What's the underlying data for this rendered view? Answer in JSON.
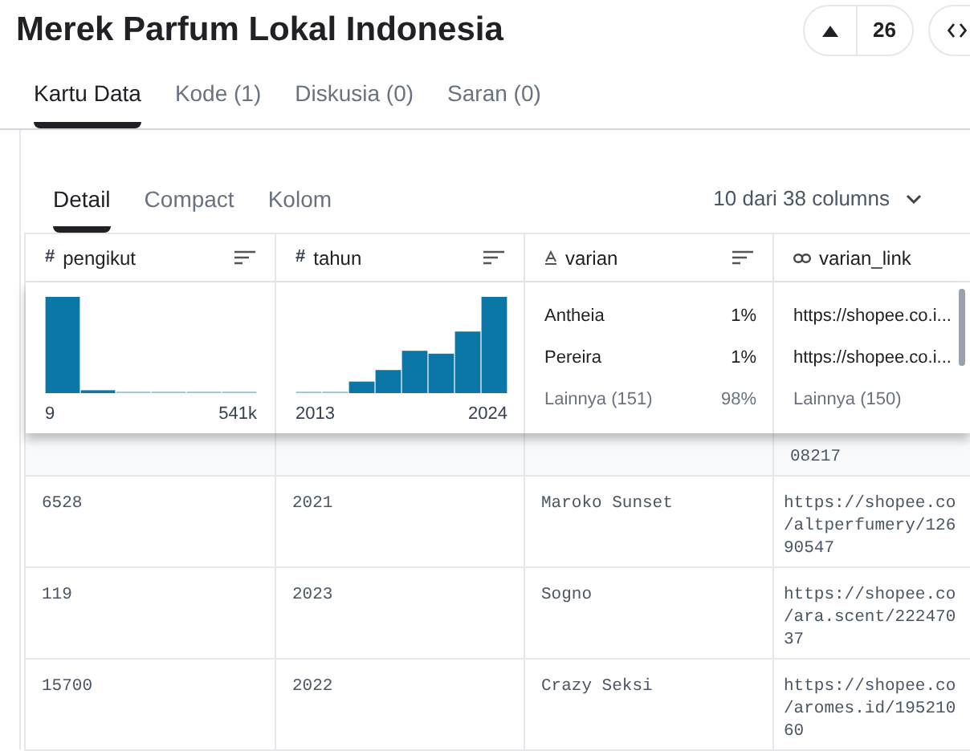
{
  "title": "Merek Parfum Lokal Indonesia",
  "vote": {
    "count": "26"
  },
  "tabs": [
    {
      "label": "Kartu Data",
      "selected": true
    },
    {
      "label": "Kode (1)",
      "selected": false
    },
    {
      "label": "Diskusia (0)",
      "selected": false
    },
    {
      "label": "Saran (0)",
      "selected": false
    }
  ],
  "view_tabs": [
    {
      "label": "Detail",
      "selected": true
    },
    {
      "label": "Compact",
      "selected": false
    },
    {
      "label": "Kolom",
      "selected": false
    }
  ],
  "columns_picker": "10 dari 38 columns",
  "columns": [
    {
      "kind": "number",
      "type_mark": "#",
      "name": "pengikut",
      "sortable": true
    },
    {
      "kind": "number",
      "type_mark": "#",
      "name": "tahun",
      "sortable": true
    },
    {
      "kind": "string",
      "name": "varian",
      "sortable": true
    },
    {
      "kind": "link",
      "name": "varian_link",
      "sortable": false
    }
  ],
  "summaries": [
    {
      "kind": "histogram",
      "min": "9",
      "max": "541k"
    },
    {
      "kind": "histogram",
      "min": "2013",
      "max": "2024"
    },
    {
      "kind": "categories",
      "items": [
        {
          "label": "Antheia",
          "share": "1%"
        },
        {
          "label": "Pereira",
          "share": "1%"
        }
      ],
      "other": {
        "label": "Lainnya (151)",
        "share": "98%"
      }
    },
    {
      "kind": "categories",
      "items": [
        {
          "label": "https://shopee.co.i..."
        },
        {
          "label": "https://shopee.co.i..."
        }
      ],
      "other": {
        "label": "Lainnya (150)"
      }
    }
  ],
  "clipped_row": {
    "varian_link": "08217"
  },
  "rows": [
    {
      "pengikut": "6528",
      "tahun": "2021",
      "varian": "Maroko Sunset",
      "varian_link": "https://shopee.co\n/altperfumery/126\n90547"
    },
    {
      "pengikut": "119",
      "tahun": "2023",
      "varian": "Sogno",
      "varian_link": "https://shopee.co\n/ara.scent/222470\n37"
    },
    {
      "pengikut": "15700",
      "tahun": "2022",
      "varian": "Crazy Seksi",
      "varian_link": "https://shopee.co\n/aromes.id/195210\n60"
    }
  ]
}
